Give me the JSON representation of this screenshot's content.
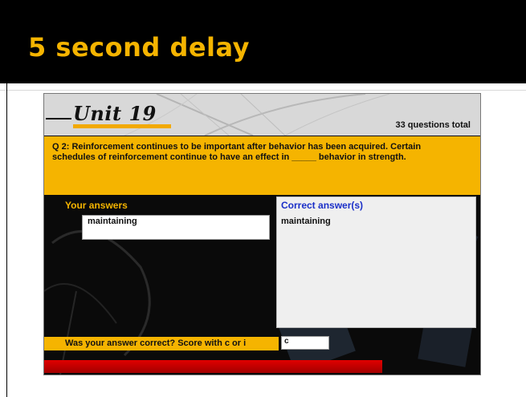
{
  "slide": {
    "title": "5 second delay"
  },
  "quiz": {
    "unit_title": "Unit 19",
    "total_questions": "33 questions total",
    "question": "Q 2: Reinforcement continues to be important after behavior has been acquired. Certain schedules of reinforcement continue to have an effect in _____ behavior in strength.",
    "your_answers_label": "Your answers",
    "your_answer_value": "maintaining",
    "correct_answers_label": "Correct answer(s)",
    "correct_answer_value": "maintaining",
    "score_prompt": "Was your answer correct? Score with c or i",
    "score_value": "c",
    "progress_fraction": 0.78
  },
  "colors": {
    "accent": "#f5b400",
    "correct_label": "#1a2fc8",
    "progress": "#e00000"
  }
}
